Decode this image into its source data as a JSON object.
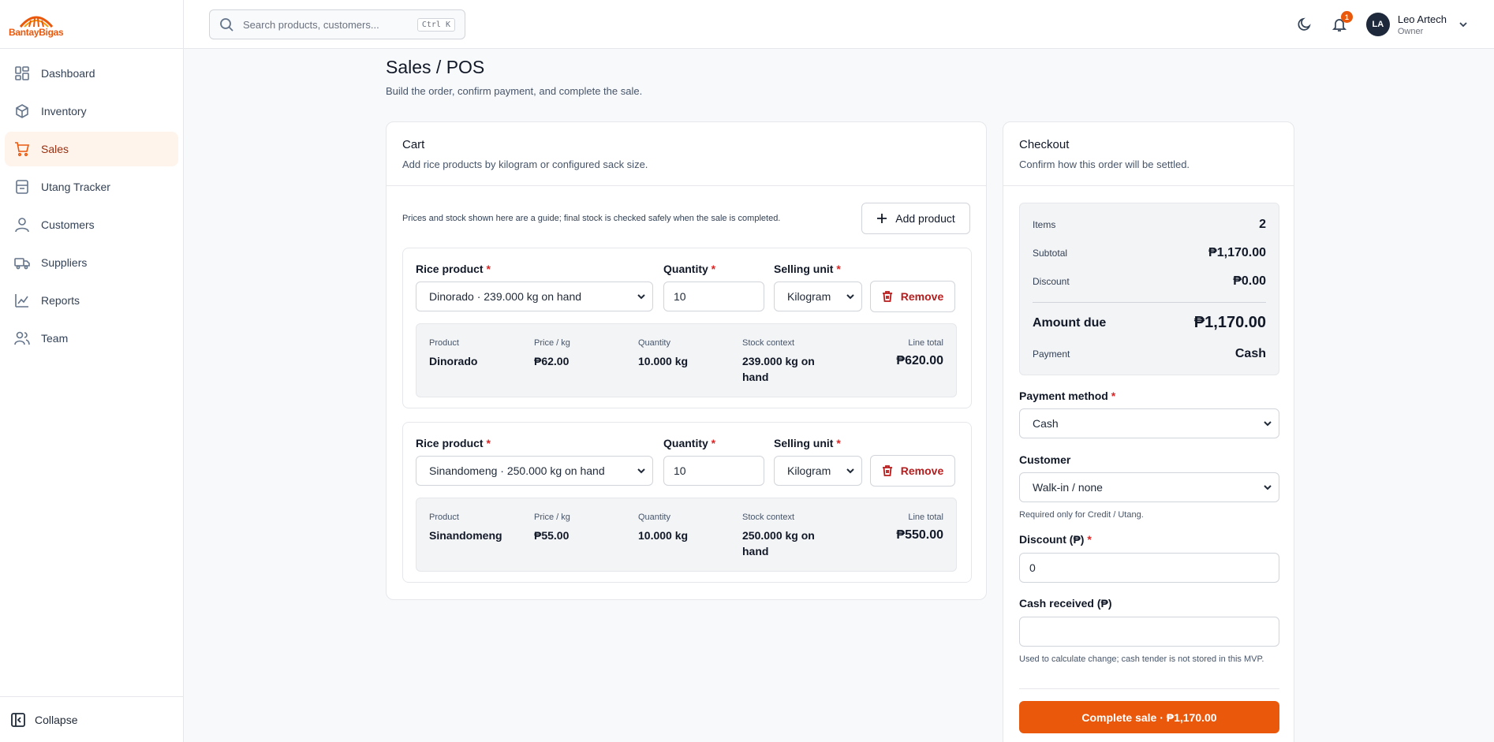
{
  "brand": {
    "name": "BantayBigas",
    "color": "#ea580c"
  },
  "search": {
    "placeholder": "Search products, customers...",
    "shortcut": "Ctrl K"
  },
  "topbar": {
    "notifications_count": "1",
    "user_initials": "LA",
    "user_name": "Leo Artech",
    "user_role": "Owner"
  },
  "sidebar": {
    "items": [
      {
        "label": "Dashboard",
        "icon": "dashboard-icon"
      },
      {
        "label": "Inventory",
        "icon": "box-icon"
      },
      {
        "label": "Sales",
        "icon": "cart-icon",
        "active": true
      },
      {
        "label": "Utang Tracker",
        "icon": "ledger-icon"
      },
      {
        "label": "Customers",
        "icon": "user-icon"
      },
      {
        "label": "Suppliers",
        "icon": "truck-icon"
      },
      {
        "label": "Reports",
        "icon": "chart-icon"
      },
      {
        "label": "Team",
        "icon": "team-icon"
      }
    ],
    "collapse_label": "Collapse"
  },
  "page": {
    "title": "Sales / POS",
    "subtitle": "Build the order, confirm payment, and complete the sale."
  },
  "cart": {
    "title": "Cart",
    "subtitle": "Add rice products by kilogram or configured sack size.",
    "guide": "Prices and stock shown here are a guide; final stock is checked safely when the sale is completed.",
    "add_label": "Add product",
    "field_labels": {
      "product": "Rice product",
      "quantity": "Quantity",
      "unit": "Selling unit"
    },
    "summary_labels": {
      "product": "Product",
      "price": "Price / kg",
      "quantity": "Quantity",
      "stock": "Stock context",
      "total": "Line total"
    },
    "remove_label": "Remove",
    "lines": [
      {
        "product_select": "Dinorado · 239.000 kg on hand",
        "quantity": "10",
        "unit": "Kilogram",
        "product": "Dinorado",
        "price": "₱62.00",
        "qty_display": "10.000 kg",
        "stock": "239.000 kg on hand",
        "total": "₱620.00"
      },
      {
        "product_select": "Sinandomeng · 250.000 kg on hand",
        "quantity": "10",
        "unit": "Kilogram",
        "product": "Sinandomeng",
        "price": "₱55.00",
        "qty_display": "10.000 kg",
        "stock": "250.000 kg on hand",
        "total": "₱550.00"
      }
    ]
  },
  "checkout": {
    "title": "Checkout",
    "subtitle": "Confirm how this order will be settled.",
    "items_label": "Items",
    "items_value": "2",
    "subtotal_label": "Subtotal",
    "subtotal_value": "₱1,170.00",
    "discount_label": "Discount",
    "discount_value": "₱0.00",
    "amount_due_label": "Amount due",
    "amount_due_value": "₱1,170.00",
    "payment_label": "Payment",
    "payment_value": "Cash",
    "payment_method_label": "Payment method",
    "payment_method_value": "Cash",
    "customer_label": "Customer",
    "customer_value": "Walk-in / none",
    "customer_help": "Required only for Credit / Utang.",
    "discount_field_label": "Discount (₱)",
    "discount_field_value": "0",
    "cash_label": "Cash received (₱)",
    "cash_value": "",
    "cash_help": "Used to calculate change; cash tender is not stored in this MVP.",
    "complete_label": "Complete sale · ₱1,170.00"
  }
}
